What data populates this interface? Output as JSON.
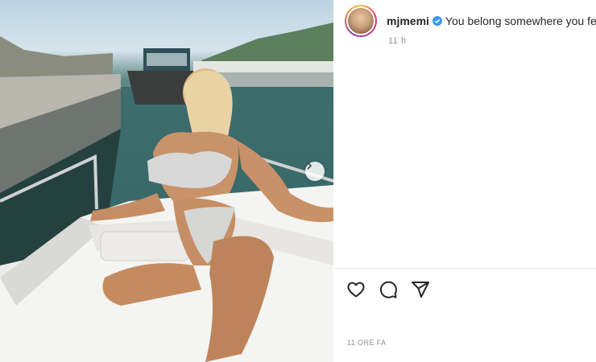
{
  "post": {
    "username": "mjmemi",
    "caption": "You belong somewhere you feel free",
    "time_ago": "11 h",
    "date_label": "11 ORE FA"
  },
  "icons": {
    "like": "heart-icon",
    "comment": "comment-icon",
    "share": "paper-plane-icon",
    "next": "chevron-right-icon",
    "verified": "verified-badge-icon"
  },
  "colors": {
    "verified": "#3897f0",
    "text": "#262626",
    "muted": "#8e8e8e"
  }
}
